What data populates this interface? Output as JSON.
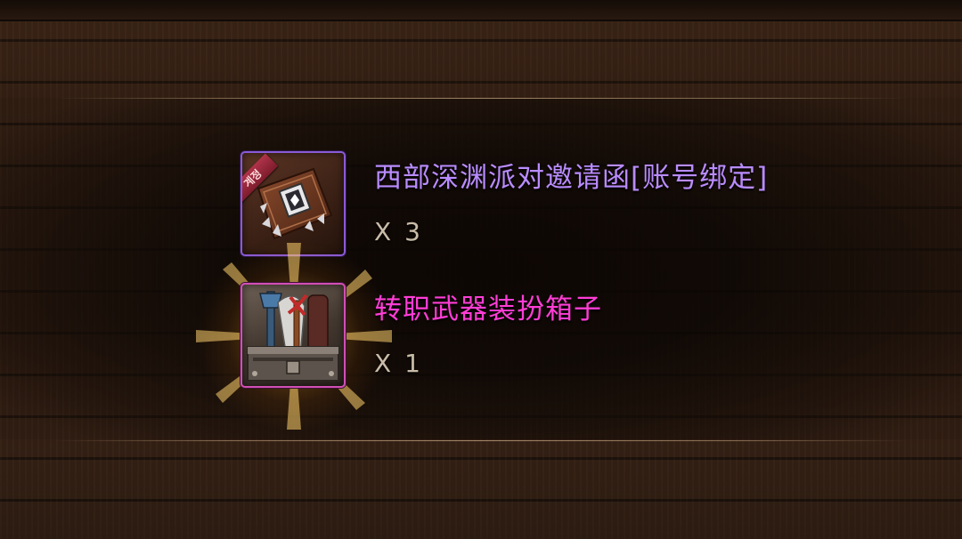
{
  "rewards": [
    {
      "name": "西部深渊派对邀请函[账号绑定]",
      "quantity": "X 3",
      "rarity_color": "#b98cff",
      "frame_color": "#8a5ad6",
      "badge": "계정",
      "icon": "invitation-card-icon"
    },
    {
      "name": "转职武器装扮箱子",
      "quantity": "X 1",
      "rarity_color": "#ff3dd6",
      "frame_color": "#d24fb5",
      "icon": "weapon-chest-icon"
    }
  ]
}
